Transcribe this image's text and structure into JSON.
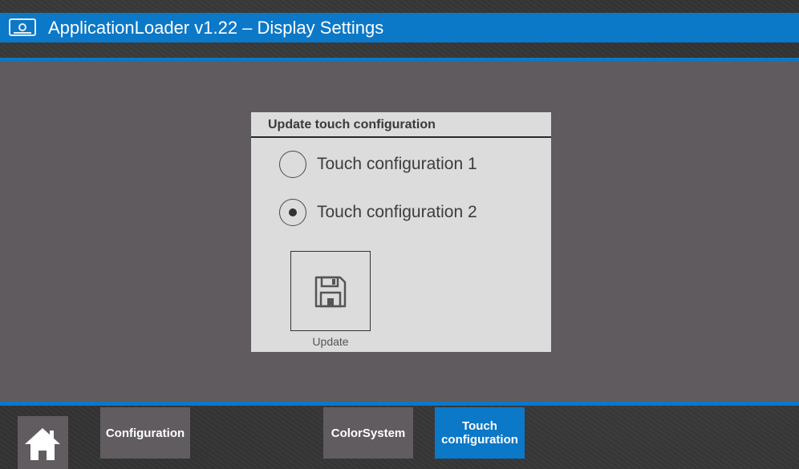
{
  "window": {
    "title": "ApplicationLoader v1.22 – Display Settings",
    "icon": "display-icon"
  },
  "panel": {
    "title": "Update touch configuration",
    "options": [
      {
        "label": "Touch configuration 1",
        "selected": false
      },
      {
        "label": "Touch configuration 2",
        "selected": true
      }
    ],
    "update_button": {
      "label": "Update",
      "icon": "floppy-disk-icon"
    }
  },
  "navbar": {
    "home_icon": "home-icon",
    "tabs": [
      {
        "label": "Configuration",
        "active": false
      },
      {
        "label": "ColorSystem",
        "active": false
      },
      {
        "label": "Touch configuration",
        "active": true
      }
    ]
  },
  "colors": {
    "accent": "#0b78c8",
    "content_bg": "#5f5b5e",
    "panel_bg": "#dcdcdc",
    "nav_button_bg": "#605c5f"
  }
}
